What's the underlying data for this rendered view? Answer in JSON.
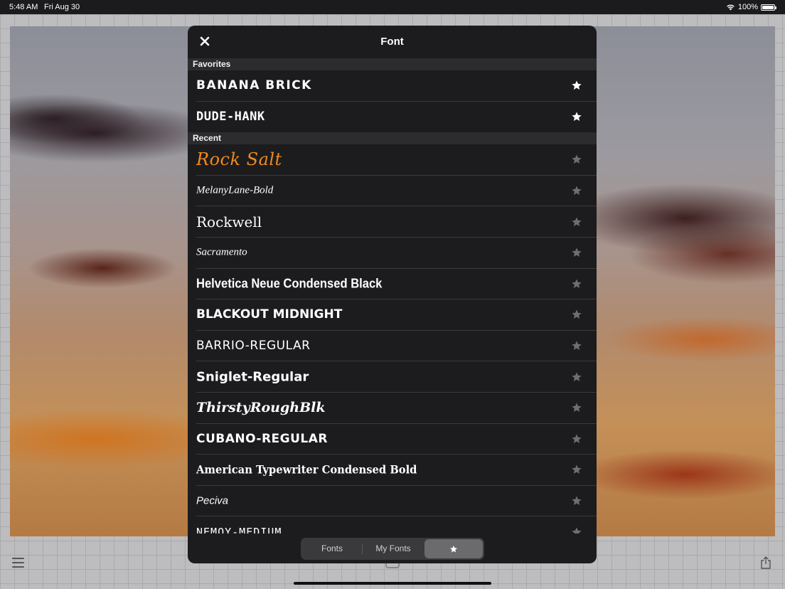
{
  "status_bar": {
    "time": "5:48 AM",
    "date": "Fri Aug 30",
    "battery": "100%"
  },
  "modal": {
    "title": "Font",
    "sections": [
      {
        "header": "Favorites",
        "items": [
          {
            "label": "BANANA BRICK",
            "favorite": true
          },
          {
            "label": "DUDE-HANK",
            "favorite": true
          }
        ]
      },
      {
        "header": "Recent",
        "items": [
          {
            "label": "Rock Salt",
            "favorite": false
          },
          {
            "label": "MelanyLane-Bold",
            "favorite": false
          },
          {
            "label": "Rockwell",
            "favorite": false
          },
          {
            "label": "Sacramento",
            "favorite": false
          },
          {
            "label": "Helvetica Neue Condensed Black",
            "favorite": false
          },
          {
            "label": "BLACKOUT MIDNIGHT",
            "favorite": false
          },
          {
            "label": "BARRIO-REGULAR",
            "favorite": false
          },
          {
            "label": "Sniglet-Regular",
            "favorite": false
          },
          {
            "label": "ThirstyRoughBlk",
            "favorite": false
          },
          {
            "label": "CUBANO-REGULAR",
            "favorite": false
          },
          {
            "label": "American Typewriter Condensed Bold",
            "favorite": false
          },
          {
            "label": "Peciva",
            "favorite": false
          },
          {
            "label": "NEMOY-MEDIUM",
            "favorite": false
          }
        ]
      }
    ],
    "segments": {
      "fonts": "Fonts",
      "my_fonts": "My Fonts",
      "favorites": "star-icon",
      "selected": "favorites"
    }
  },
  "colors": {
    "favorite_star": "#ffffff",
    "inactive_star": "#6e6e70",
    "accent_rock_salt": "#f08a1e"
  }
}
